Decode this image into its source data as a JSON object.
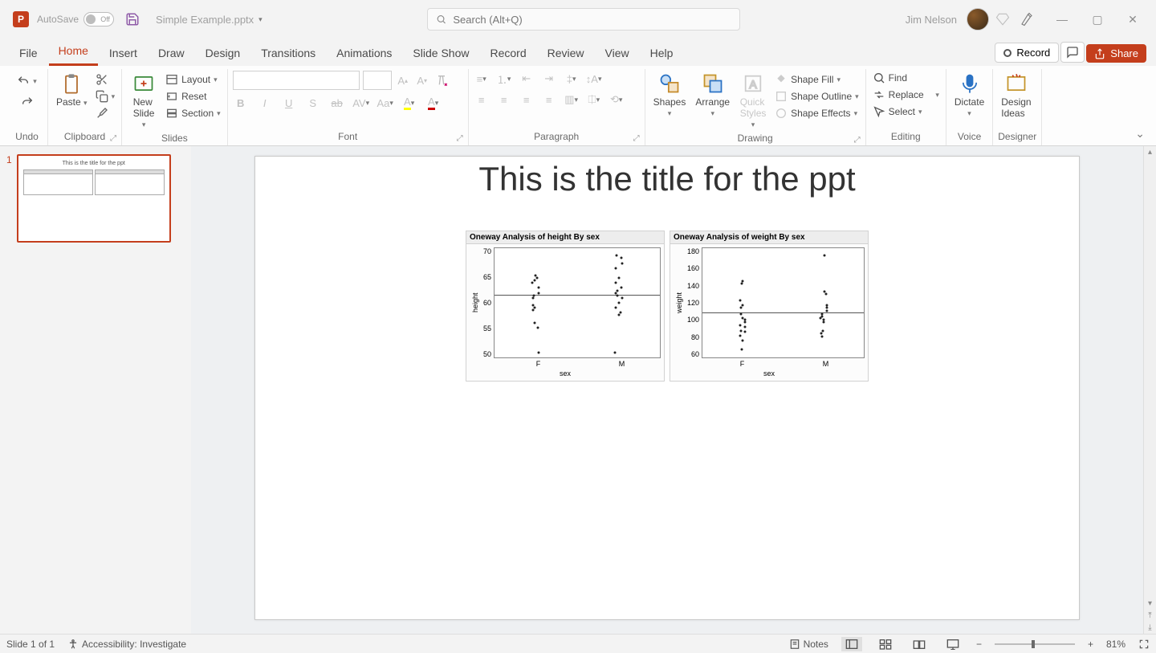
{
  "titlebar": {
    "autosave_label": "AutoSave",
    "autosave_off": "Off",
    "doc_title": "Simple Example.pptx",
    "search_placeholder": "Search (Alt+Q)",
    "user_name": "Jim Nelson"
  },
  "tabs": [
    "File",
    "Home",
    "Insert",
    "Draw",
    "Design",
    "Transitions",
    "Animations",
    "Slide Show",
    "Record",
    "Review",
    "View",
    "Help"
  ],
  "tab_active": "Home",
  "record_btn": "Record",
  "share_btn": "Share",
  "ribbon": {
    "undo": "Undo",
    "clipboard": {
      "paste": "Paste",
      "label": "Clipboard"
    },
    "slides": {
      "new_slide": "New\nSlide",
      "layout": "Layout",
      "reset": "Reset",
      "section": "Section",
      "label": "Slides"
    },
    "font": {
      "label": "Font"
    },
    "paragraph": {
      "label": "Paragraph"
    },
    "drawing": {
      "shapes": "Shapes",
      "arrange": "Arrange",
      "quick_styles": "Quick\nStyles",
      "shape_fill": "Shape Fill",
      "shape_outline": "Shape Outline",
      "shape_effects": "Shape Effects",
      "label": "Drawing"
    },
    "editing": {
      "find": "Find",
      "replace": "Replace",
      "select": "Select",
      "label": "Editing"
    },
    "voice": {
      "dictate": "Dictate",
      "label": "Voice"
    },
    "designer": {
      "design_ideas": "Design\nIdeas",
      "label": "Designer"
    }
  },
  "thumbnail": {
    "number": "1",
    "title": "This is the title for the ppt"
  },
  "slide": {
    "title": "This is the title for the ppt"
  },
  "chart_data": [
    {
      "type": "scatter",
      "title": "Oneway Analysis of height By sex",
      "xlabel": "sex",
      "ylabel": "height",
      "categories": [
        "F",
        "M"
      ],
      "ylim": [
        50,
        72
      ],
      "yticks": [
        70,
        65,
        60,
        55,
        50
      ],
      "mean_line": 62.5,
      "series": [
        {
          "name": "F",
          "values": [
            51,
            56,
            57,
            59.5,
            60,
            60.5,
            62,
            62.5,
            63,
            64,
            65,
            65.5,
            66,
            66.5
          ]
        },
        {
          "name": "M",
          "values": [
            51,
            58.5,
            59,
            60,
            61,
            62,
            62.5,
            63,
            63.5,
            64,
            65,
            66,
            68,
            69,
            70,
            70.5
          ]
        }
      ]
    },
    {
      "type": "scatter",
      "title": "Oneway Analysis of weight By sex",
      "xlabel": "sex",
      "ylabel": "weight",
      "categories": [
        "F",
        "M"
      ],
      "ylim": [
        55,
        180
      ],
      "yticks": [
        180,
        160,
        140,
        120,
        100,
        80,
        60
      ],
      "mean_line": 106,
      "series": [
        {
          "name": "F",
          "values": [
            64,
            74,
            80,
            84,
            85,
            90,
            92,
            95,
            98,
            100,
            105,
            112,
            115,
            120,
            140,
            142
          ]
        },
        {
          "name": "M",
          "values": [
            79,
            83,
            85,
            95,
            98,
            100,
            102,
            105,
            108,
            112,
            115,
            128,
            130,
            172
          ]
        }
      ]
    }
  ],
  "statusbar": {
    "slide_info": "Slide 1 of 1",
    "accessibility": "Accessibility: Investigate",
    "notes": "Notes",
    "zoom": "81%"
  }
}
